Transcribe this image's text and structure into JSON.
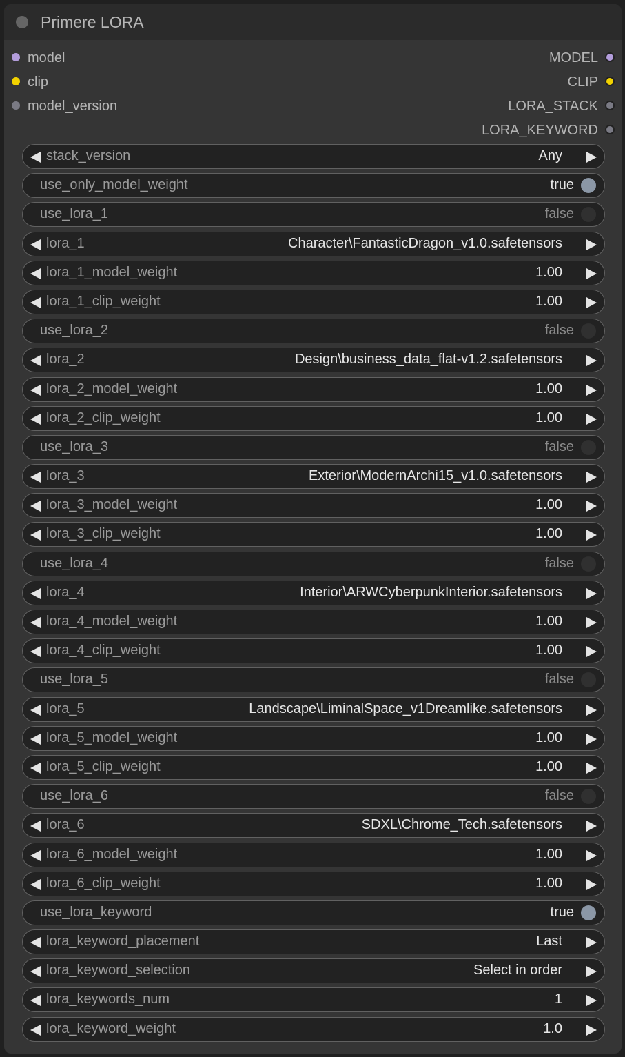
{
  "node": {
    "title": "Primere LORA"
  },
  "inputs": [
    {
      "label": "model",
      "color": "#b39ddb"
    },
    {
      "label": "clip",
      "color": "#f2d200"
    },
    {
      "label": "model_version",
      "color": "#7a7a84"
    }
  ],
  "outputs": [
    {
      "label": "MODEL",
      "color": "#b39ddb"
    },
    {
      "label": "CLIP",
      "color": "#f2d200"
    },
    {
      "label": "LORA_STACK",
      "color": "#7a7a84"
    },
    {
      "label": "LORA_KEYWORD",
      "color": "#7a7a84"
    }
  ],
  "widgets": [
    {
      "type": "combo",
      "name": "stack_version",
      "value": "Any"
    },
    {
      "type": "toggle",
      "name": "use_only_model_weight",
      "value": "true",
      "on": true
    },
    {
      "type": "toggle",
      "name": "use_lora_1",
      "value": "false",
      "on": false
    },
    {
      "type": "combo",
      "name": "lora_1",
      "value": "Character\\FantasticDragon_v1.0.safetensors"
    },
    {
      "type": "number",
      "name": "lora_1_model_weight",
      "value": "1.00"
    },
    {
      "type": "number",
      "name": "lora_1_clip_weight",
      "value": "1.00"
    },
    {
      "type": "toggle",
      "name": "use_lora_2",
      "value": "false",
      "on": false
    },
    {
      "type": "combo",
      "name": "lora_2",
      "value": "Design\\business_data_flat-v1.2.safetensors"
    },
    {
      "type": "number",
      "name": "lora_2_model_weight",
      "value": "1.00"
    },
    {
      "type": "number",
      "name": "lora_2_clip_weight",
      "value": "1.00"
    },
    {
      "type": "toggle",
      "name": "use_lora_3",
      "value": "false",
      "on": false
    },
    {
      "type": "combo",
      "name": "lora_3",
      "value": "Exterior\\ModernArchi15_v1.0.safetensors"
    },
    {
      "type": "number",
      "name": "lora_3_model_weight",
      "value": "1.00"
    },
    {
      "type": "number",
      "name": "lora_3_clip_weight",
      "value": "1.00"
    },
    {
      "type": "toggle",
      "name": "use_lora_4",
      "value": "false",
      "on": false
    },
    {
      "type": "combo",
      "name": "lora_4",
      "value": "Interior\\ARWCyberpunkInterior.safetensors"
    },
    {
      "type": "number",
      "name": "lora_4_model_weight",
      "value": "1.00"
    },
    {
      "type": "number",
      "name": "lora_4_clip_weight",
      "value": "1.00"
    },
    {
      "type": "toggle",
      "name": "use_lora_5",
      "value": "false",
      "on": false
    },
    {
      "type": "combo",
      "name": "lora_5",
      "value": "Landscape\\LiminalSpace_v1Dreamlike.safetensors"
    },
    {
      "type": "number",
      "name": "lora_5_model_weight",
      "value": "1.00"
    },
    {
      "type": "number",
      "name": "lora_5_clip_weight",
      "value": "1.00"
    },
    {
      "type": "toggle",
      "name": "use_lora_6",
      "value": "false",
      "on": false
    },
    {
      "type": "combo",
      "name": "lora_6",
      "value": "SDXL\\Chrome_Tech.safetensors"
    },
    {
      "type": "number",
      "name": "lora_6_model_weight",
      "value": "1.00"
    },
    {
      "type": "number",
      "name": "lora_6_clip_weight",
      "value": "1.00"
    },
    {
      "type": "toggle",
      "name": "use_lora_keyword",
      "value": "true",
      "on": true
    },
    {
      "type": "combo",
      "name": "lora_keyword_placement",
      "value": "Last"
    },
    {
      "type": "combo",
      "name": "lora_keyword_selection",
      "value": "Select in order"
    },
    {
      "type": "number",
      "name": "lora_keywords_num",
      "value": "1"
    },
    {
      "type": "number",
      "name": "lora_keyword_weight",
      "value": "1.0"
    }
  ]
}
